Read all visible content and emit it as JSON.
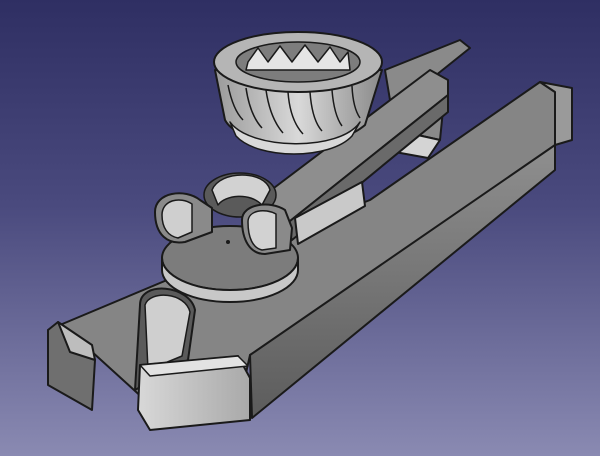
{
  "viewport": {
    "background_top": "#2f2f63",
    "background_bottom": "#8a8ab2"
  },
  "model": {
    "shade_top": "#8c8c8c",
    "shade_side": "#6c6c6c",
    "shade_dark": "#4e4e4e",
    "shade_light": "#cfcfcf",
    "shade_bright": "#e6e6e6"
  }
}
